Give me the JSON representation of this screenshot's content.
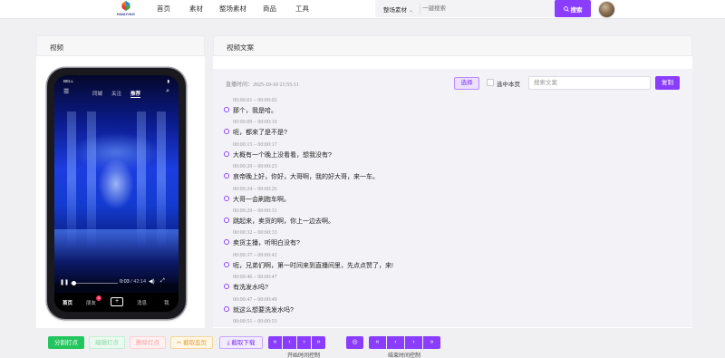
{
  "brand": {
    "logo_text": "HWAYING"
  },
  "nav": {
    "items": [
      "首页",
      "素材",
      "整场素材",
      "商品",
      "工具"
    ]
  },
  "search": {
    "category": "整场素材",
    "placeholder": "一键搜索",
    "button": "搜索"
  },
  "panels": {
    "video_title": "视频",
    "copy_title": "视频文案"
  },
  "phone": {
    "carrier": "BELL",
    "top_tabs": [
      "同城",
      "关注",
      "推荐"
    ],
    "active_tab": "推荐",
    "time_current": "0:03",
    "time_total": "/ 42:14",
    "bottom_nav": [
      "首页",
      "朋友",
      "+",
      "消息",
      "我"
    ],
    "badge": "5"
  },
  "transcript": {
    "live_time_label": "直播时间：2025-10-10 21:55:11",
    "select_button": "选择",
    "select_page_label": "选中本页",
    "search_placeholder": "搜索文案",
    "copy_button": "复制",
    "segments": [
      {
        "time": "00:00:01 – 00:00:02",
        "text": "那个，我是哈。"
      },
      {
        "time": "00:00:09 – 00:00:10",
        "text": "呃，都来了是不是?"
      },
      {
        "time": "00:00:15 – 00:00:17",
        "text": "大概有一个晚上没看看，想我没有?"
      },
      {
        "time": "00:00:20 – 00:00:23",
        "text": "哀帝晚上好，你好，大哥啊，我的好大哥，来一车。"
      },
      {
        "time": "00:00:24 – 00:00:26",
        "text": "大哥一会刷跑车啊。"
      },
      {
        "time": "00:00:29 – 00:00:31",
        "text": "跳起来，卖货的啊，你上一边去啊。"
      },
      {
        "time": "00:00:32 – 00:00:33",
        "text": "卖货主播，听明白没有?"
      },
      {
        "time": "00:00:37 – 00:00:42",
        "text": "呃，兄弟们啊，第一时间来到直播间里，先点点赞了，来!"
      },
      {
        "time": "00:00:46 – 00:00:47",
        "text": "有洗发水吗?"
      },
      {
        "time": "00:00:47 – 00:00:49",
        "text": "就这么想要洗发水吗?"
      },
      {
        "time": "00:00:51 – 00:00:53",
        "text": ""
      }
    ]
  },
  "actions": {
    "split": "分割打点",
    "edit": "编辑打点",
    "delete": "删除打点",
    "clip": "截取监剪",
    "download": "截取下载",
    "start_caption": "开始时间控制",
    "end_caption": "结束时间控制"
  },
  "colors": {
    "accent": "#8b3dff",
    "split": "#22c55e"
  }
}
